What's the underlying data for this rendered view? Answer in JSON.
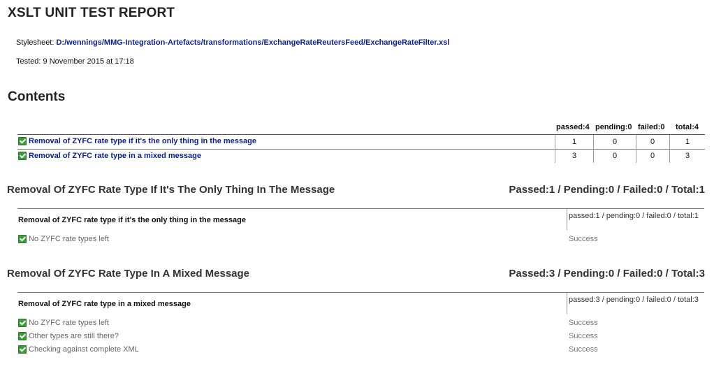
{
  "report": {
    "title": "XSLT UNIT TEST REPORT",
    "stylesheet_label": "Stylesheet:",
    "stylesheet_path": "D:/wennings/MMG-Integration-Artefacts/transformations/ExchangeRateReutersFeed/ExchangeRateFilter.xsl",
    "tested_text": "Tested: 9 November 2015 at 17:18"
  },
  "contents": {
    "heading": "Contents",
    "columns": [
      "passed:4",
      "pending:0",
      "failed:0",
      "total:4"
    ],
    "rows": [
      {
        "label": "Removal of ZYFC rate type if it's the only thing in the message",
        "passed": "1",
        "pending": "0",
        "failed": "0",
        "total": "1"
      },
      {
        "label": "Removal of ZYFC rate type in a mixed message",
        "passed": "3",
        "pending": "0",
        "failed": "0",
        "total": "3"
      }
    ]
  },
  "sections": [
    {
      "title": "Removal Of ZYFC Rate Type If It's The Only Thing In The Message",
      "totals": "Passed:1 / Pending:0 / Failed:0 / Total:1",
      "scenario_label": "Removal of ZYFC rate type if it's the only thing in the message",
      "scenario_stats": "passed:1 / pending:0 / failed:0 / total:1",
      "cases": [
        {
          "label": "No ZYFC rate types left",
          "status": "Success"
        }
      ]
    },
    {
      "title": "Removal Of ZYFC Rate Type In A Mixed Message",
      "totals": "Passed:3 / Pending:0 / Failed:0 / Total:3",
      "scenario_label": "Removal of ZYFC rate type in a mixed message",
      "scenario_stats": "passed:3 / pending:0 / failed:0 / total:3",
      "cases": [
        {
          "label": "No ZYFC rate types left",
          "status": "Success"
        },
        {
          "label": "Other types are still there?",
          "status": "Success"
        },
        {
          "label": "Checking against complete XML",
          "status": "Success"
        }
      ]
    }
  ],
  "colors": {
    "link": "#0b1f8f",
    "check": "#3a9a3a",
    "text": "#333333"
  },
  "icons": {
    "pass": "check-icon"
  }
}
